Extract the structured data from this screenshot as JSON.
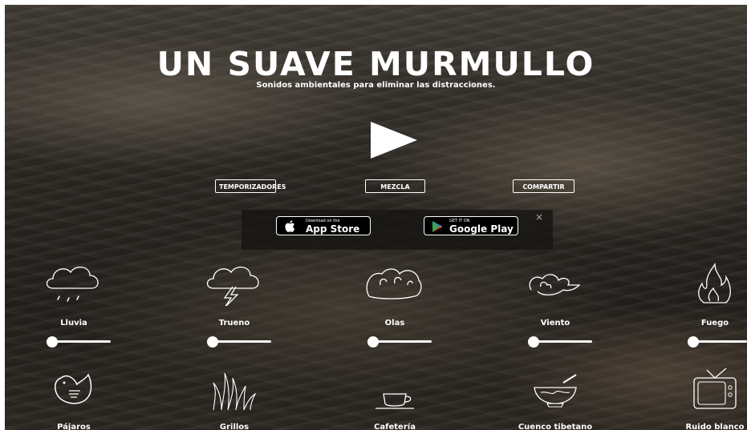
{
  "hero": {
    "title": "UN SUAVE MURMULLO",
    "subtitle": "Sonidos ambientales para eliminar las distracciones."
  },
  "controls": {
    "timers_label": "TEMPORIZADORES",
    "mix_label": "MEZCLA",
    "share_label": "COMPARTIR"
  },
  "promo": {
    "appstore_small": "Download on the",
    "appstore_big": "App Store",
    "googleplay_small": "GET IT ON",
    "googleplay_big": "Google Play",
    "close": "×"
  },
  "sounds": [
    {
      "label": "Lluvia",
      "icon": "rain-cloud-icon",
      "volume": 0
    },
    {
      "label": "Trueno",
      "icon": "thunder-cloud-icon",
      "volume": 0
    },
    {
      "label": "Olas",
      "icon": "waves-icon",
      "volume": 0
    },
    {
      "label": "Viento",
      "icon": "wind-icon",
      "volume": 0
    },
    {
      "label": "Fuego",
      "icon": "fire-icon",
      "volume": 0
    },
    {
      "label": "Pájaros",
      "icon": "bird-icon"
    },
    {
      "label": "Grillos",
      "icon": "grass-icon"
    },
    {
      "label": "Cafetería",
      "icon": "coffee-cup-icon"
    },
    {
      "label": "Cuenco tibetano",
      "icon": "singing-bowl-icon"
    },
    {
      "label": "Ruido blanco",
      "icon": "tv-icon"
    }
  ],
  "colors": {
    "foreground": "#ffffff",
    "background": "#2a2621"
  }
}
